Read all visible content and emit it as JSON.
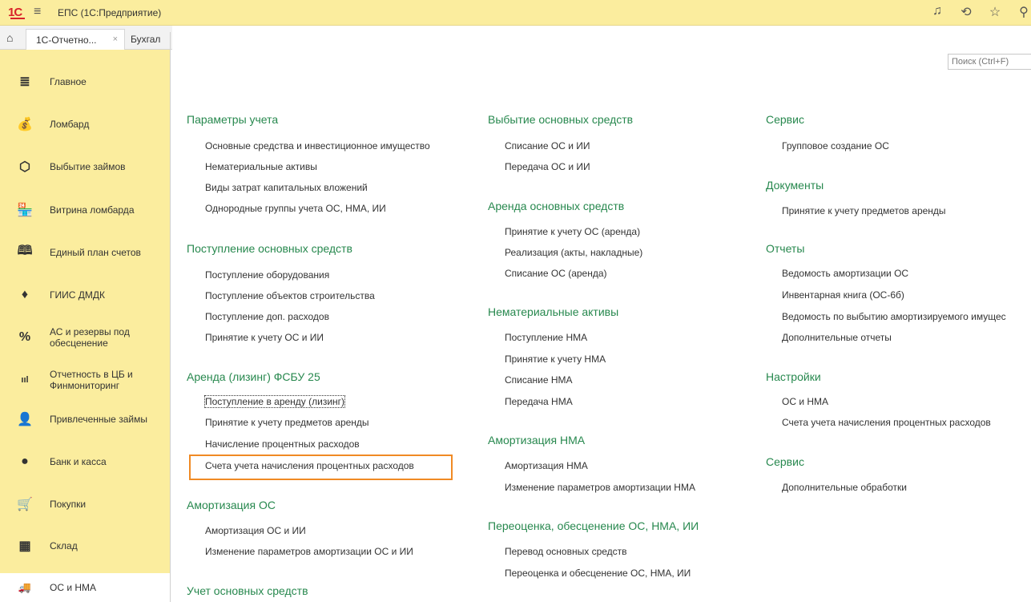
{
  "titlebar": {
    "logo": "1С",
    "title": "ЕПС  (1С:Предприятие)"
  },
  "tabs": [
    {
      "label": "1С-Отчетно...",
      "close": "×"
    },
    {
      "label": "Бухгал"
    }
  ],
  "search": {
    "placeholder": "Поиск (Ctrl+F)"
  },
  "sidebar": [
    {
      "label": "Главное",
      "icon": "≣"
    },
    {
      "label": "Ломбард",
      "icon": "💰"
    },
    {
      "label": "Выбытие займов",
      "icon": "⬡"
    },
    {
      "label": "Витрина ломбарда",
      "icon": "🏪"
    },
    {
      "label": "Единый план счетов",
      "icon": "🕮"
    },
    {
      "label": "ГИИС ДМДК",
      "icon": "♦"
    },
    {
      "label": "АС и резервы под обесценение",
      "icon": "%"
    },
    {
      "label": "Отчетность в ЦБ и Финмониторинг",
      "icon": "ııl"
    },
    {
      "label": "Привлеченные займы",
      "icon": "👤"
    },
    {
      "label": "Банк и касса",
      "icon": "●"
    },
    {
      "label": "Покупки",
      "icon": "🛒"
    },
    {
      "label": "Склад",
      "icon": "▦"
    },
    {
      "label": "ОС и НМА",
      "icon": "🚚"
    }
  ],
  "col1": {
    "h1": "Параметры учета",
    "l1": [
      "Основные средства и инвестиционное имущество",
      "Нематериальные активы",
      "Виды затрат капитальных вложений",
      "Однородные группы учета ОС, НМА, ИИ"
    ],
    "h2": "Поступление основных средств",
    "l2": [
      "Поступление оборудования",
      "Поступление объектов строительства",
      "Поступление доп. расходов",
      "Принятие к учету ОС и ИИ"
    ],
    "h3": "Аренда (лизинг) ФСБУ 25",
    "l3": [
      "Поступление в аренду (лизинг)",
      "Принятие к учету предметов аренды",
      "Начисление процентных расходов",
      "Счета учета начисления процентных расходов"
    ],
    "h4": "Амортизация ОС",
    "l4": [
      "Амортизация ОС и ИИ",
      "Изменение параметров амортизации ОС и ИИ"
    ],
    "h5": "Учет основных средств"
  },
  "col2": {
    "h1": "Выбытие основных средств",
    "l1": [
      "Списание ОС и ИИ",
      "Передача ОС и ИИ"
    ],
    "h2": "Аренда основных средств",
    "l2": [
      "Принятие к учету ОС (аренда)",
      "Реализация (акты, накладные)",
      "Списание ОС (аренда)"
    ],
    "h3": "Нематериальные активы",
    "l3": [
      "Поступление НМА",
      "Принятие к учету НМА",
      "Списание НМА",
      "Передача НМА"
    ],
    "h4": "Амортизация НМА",
    "l4": [
      "Амортизация НМА",
      "Изменение параметров амортизации НМА"
    ],
    "h5": "Переоценка, обесценение ОС, НМА, ИИ",
    "l5": [
      "Перевод основных средств",
      "Переоценка и обесценение ОС, НМА, ИИ"
    ]
  },
  "col3": {
    "h1": "Сервис",
    "l1": [
      "Групповое создание ОС"
    ],
    "h2": "Документы",
    "l2": [
      "Принятие к учету предметов аренды"
    ],
    "h3": "Отчеты",
    "l3": [
      "Ведомость амортизации ОС",
      "Инвентарная книга (ОС-6б)",
      "Ведомость по выбытию амортизируемого имущес",
      "Дополнительные отчеты"
    ],
    "h4": "Настройки",
    "l4": [
      "ОС и НМА",
      "Счета учета начисления процентных расходов"
    ],
    "h5": "Сервис",
    "l5": [
      "Дополнительные обработки"
    ]
  },
  "colors": {
    "accent_green": "#27884e",
    "sidebar_bg": "#fbed9e",
    "highlight": "#f08a24"
  }
}
